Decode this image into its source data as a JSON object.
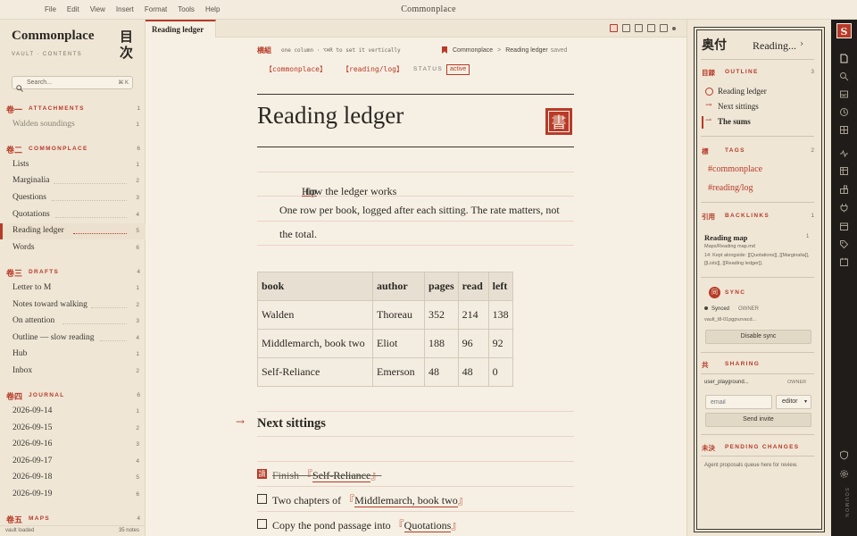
{
  "menu": {
    "items": [
      "File",
      "Edit",
      "View",
      "Insert",
      "Format",
      "Tools",
      "Help"
    ],
    "app_title": "Commonplace"
  },
  "sidebar": {
    "vault_title": "Commonplace",
    "vault_subtitle": "VAULT · CONTENTS",
    "vault_kanji": "目次",
    "search_placeholder": "Search...",
    "search_shortcut": "⌘ K",
    "groups": [
      {
        "kanji": "卷一",
        "name": "ATTACHMENTS",
        "count": "1",
        "items": [
          {
            "label": "Walden soundings",
            "count": "1"
          }
        ]
      },
      {
        "kanji": "卷二",
        "name": "COMMONPLACE",
        "count": "6",
        "items": [
          {
            "label": "Lists",
            "count": "1"
          },
          {
            "label": "Marginalia",
            "count": "2"
          },
          {
            "label": "Questions",
            "count": "3"
          },
          {
            "label": "Quotations",
            "count": "4"
          },
          {
            "label": "Reading ledger",
            "count": "5"
          },
          {
            "label": "Words",
            "count": "6"
          }
        ]
      },
      {
        "kanji": "卷三",
        "name": "DRAFTS",
        "count": "4",
        "items": [
          {
            "label": "Letter to M",
            "count": "1"
          },
          {
            "label": "Notes toward walking",
            "count": "2"
          },
          {
            "label": "On attention",
            "count": "3"
          },
          {
            "label": "Outline — slow reading",
            "count": "4"
          },
          {
            "label": "Hub",
            "count": "1"
          },
          {
            "label": "Inbox",
            "count": "2"
          }
        ]
      },
      {
        "kanji": "卷四",
        "name": "JOURNAL",
        "count": "6",
        "items": [
          {
            "label": "2026-09-14",
            "count": "1"
          },
          {
            "label": "2026-09-15",
            "count": "2"
          },
          {
            "label": "2026-09-16",
            "count": "3"
          },
          {
            "label": "2026-09-17",
            "count": "4"
          },
          {
            "label": "2026-09-18",
            "count": "5"
          },
          {
            "label": "2026-09-19",
            "count": "6"
          }
        ]
      },
      {
        "kanji": "卷五",
        "name": "MAPS",
        "count": "4",
        "items": []
      }
    ],
    "status_left": "vault loaded",
    "status_right": "35 notes"
  },
  "tabs": {
    "active": "Reading ledger"
  },
  "doc": {
    "meta_kanji": "横組",
    "meta_hint": "one column · ⌥⌘R to set it vertically",
    "crumb_parent": "Commonplace",
    "crumb_sep": ">",
    "crumb_current": "Reading ledger",
    "crumb_status": "saved",
    "tags": [
      "【commonplace】",
      "【reading/log】"
    ],
    "status_label": "STATUS",
    "status_value": "active",
    "title": "Reading ledger",
    "seal": "書",
    "callout_line1_tip": "!tip",
    "callout_line1_rest": " How the ledger works",
    "callout_line2": "One row per book, logged after each sitting. The rate matters, not",
    "callout_line3": "the total.",
    "table": {
      "headers": [
        "book",
        "author",
        "pages",
        "read",
        "left"
      ],
      "rows": [
        [
          "Walden",
          "Thoreau",
          "352",
          "214",
          "138"
        ],
        [
          "Middlemarch, book two",
          "Eliot",
          "188",
          "96",
          "92"
        ],
        [
          "Self-Reliance",
          "Emerson",
          "48",
          "48",
          "0"
        ]
      ]
    },
    "section_arrow": "→",
    "section_heading": "Next sittings",
    "tasks": [
      {
        "done": true,
        "prefix": "Finish ",
        "link": "Self-Reliance",
        "done_mark": "讀"
      },
      {
        "done": false,
        "prefix": "Two chapters of ",
        "link": "Middlemarch, book two"
      },
      {
        "done": false,
        "prefix": "Copy the pond passage into ",
        "link": "Quotations"
      }
    ],
    "bracket_open": "『",
    "bracket_close": "』"
  },
  "right_panel": {
    "head_kanji": "奥付",
    "head_title": "Reading...",
    "head_chevron": "›",
    "outline": {
      "kanji": "目録",
      "label": "OUTLINE",
      "count": "3",
      "items": [
        {
          "marker": "",
          "label": "Reading ledger"
        },
        {
          "marker": "→",
          "label": "Next sittings"
        },
        {
          "marker": "⇀",
          "label": "The sums"
        }
      ]
    },
    "tags": {
      "kanji": "標",
      "label": "TAGS",
      "count": "2",
      "items": [
        "#commonplace",
        "#reading/log"
      ]
    },
    "backlinks": {
      "kanji": "引用",
      "label": "BACKLINKS",
      "count": "1",
      "title": "Reading map",
      "item_count": "1",
      "path": "Maps/Reading map.md",
      "snippet": "14: Kept alongside: [[Quotations]], [[Marginalia]], [[Lists]], [[Reading ledger]]."
    },
    "sync": {
      "seal": "同",
      "label": "SYNC",
      "status": "Synced",
      "role": "OWNER",
      "vault": "vault_t8-01pgpvzvacd...",
      "button": "Disable sync"
    },
    "sharing": {
      "kanji": "共",
      "label": "SHARING",
      "user": "user_playground...",
      "role": "OWNER",
      "email_placeholder": "email",
      "role_select": "editor",
      "button": "Send invite"
    },
    "pending": {
      "kanji": "未決",
      "label": "PENDING CHANGES",
      "note": "Agent proposals queue here for review."
    }
  },
  "rail": {
    "logo": "S",
    "brand": "SOUMON",
    "icons": [
      "file-icon",
      "search-icon",
      "inbox-icon",
      "history-icon",
      "grid-icon",
      "activity-icon",
      "table-icon",
      "blocks-icon",
      "plug-icon",
      "calendar-grid-icon",
      "tag-icon",
      "calendar-icon",
      "shield-icon",
      "gear-icon"
    ]
  },
  "colors": {
    "accent": "#b83a28",
    "paper": "#f6f0e4",
    "sidebar": "#efe6d6",
    "ink": "#2b2722",
    "rail": "#1f1c19"
  }
}
